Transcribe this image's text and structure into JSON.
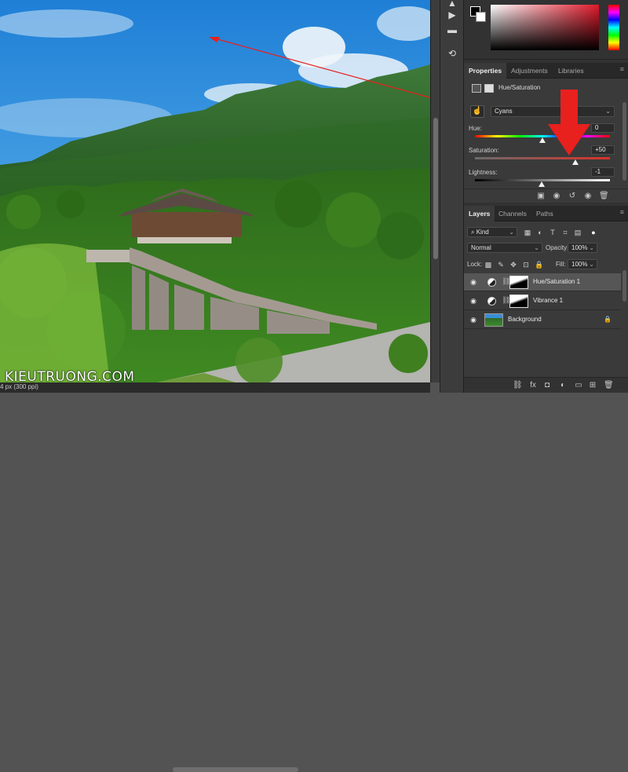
{
  "watermark": "KIEUTRUONG.COM",
  "status": {
    "doc_info": "4 px (300 ppi)"
  },
  "tools": [
    {
      "icon": "move-icon",
      "glyph": "▲"
    },
    {
      "icon": "play-icon",
      "glyph": "▶"
    },
    {
      "icon": "comment-icon",
      "glyph": "▬"
    },
    {
      "icon": "glyph-icon",
      "glyph": "⊕"
    },
    {
      "icon": "history-icon",
      "glyph": "⟲"
    }
  ],
  "color_panel": {
    "foreground": "#000000",
    "background": "#ffffff",
    "hue_color": "#e0192a"
  },
  "properties": {
    "tabs": [
      {
        "label": "Properties",
        "active": true
      },
      {
        "label": "Adjustments",
        "active": false
      },
      {
        "label": "Libraries",
        "active": false
      }
    ],
    "title": "Hue/Saturation",
    "preset": "Cyans",
    "hue": {
      "label": "Hue:",
      "value": "0"
    },
    "saturation": {
      "label": "Saturation:",
      "value": "+50"
    },
    "lightness": {
      "label": "Lightness:",
      "value": "-1"
    }
  },
  "layers": {
    "tabs": [
      {
        "label": "Layers",
        "active": true
      },
      {
        "label": "Channels",
        "active": false
      },
      {
        "label": "Paths",
        "active": false
      }
    ],
    "filter_label": "Kind",
    "blend_mode": "Normal",
    "opacity_label": "Opacity:",
    "opacity_value": "100%",
    "lock_label": "Lock:",
    "fill_label": "Fill:",
    "fill_value": "100%",
    "items": [
      {
        "name": "Hue/Saturation 1",
        "selected": true
      },
      {
        "name": "Vibrance 1",
        "selected": false
      },
      {
        "name": "Background",
        "selected": false
      }
    ]
  },
  "annotation": {
    "arrow_color": "#e8201e"
  }
}
